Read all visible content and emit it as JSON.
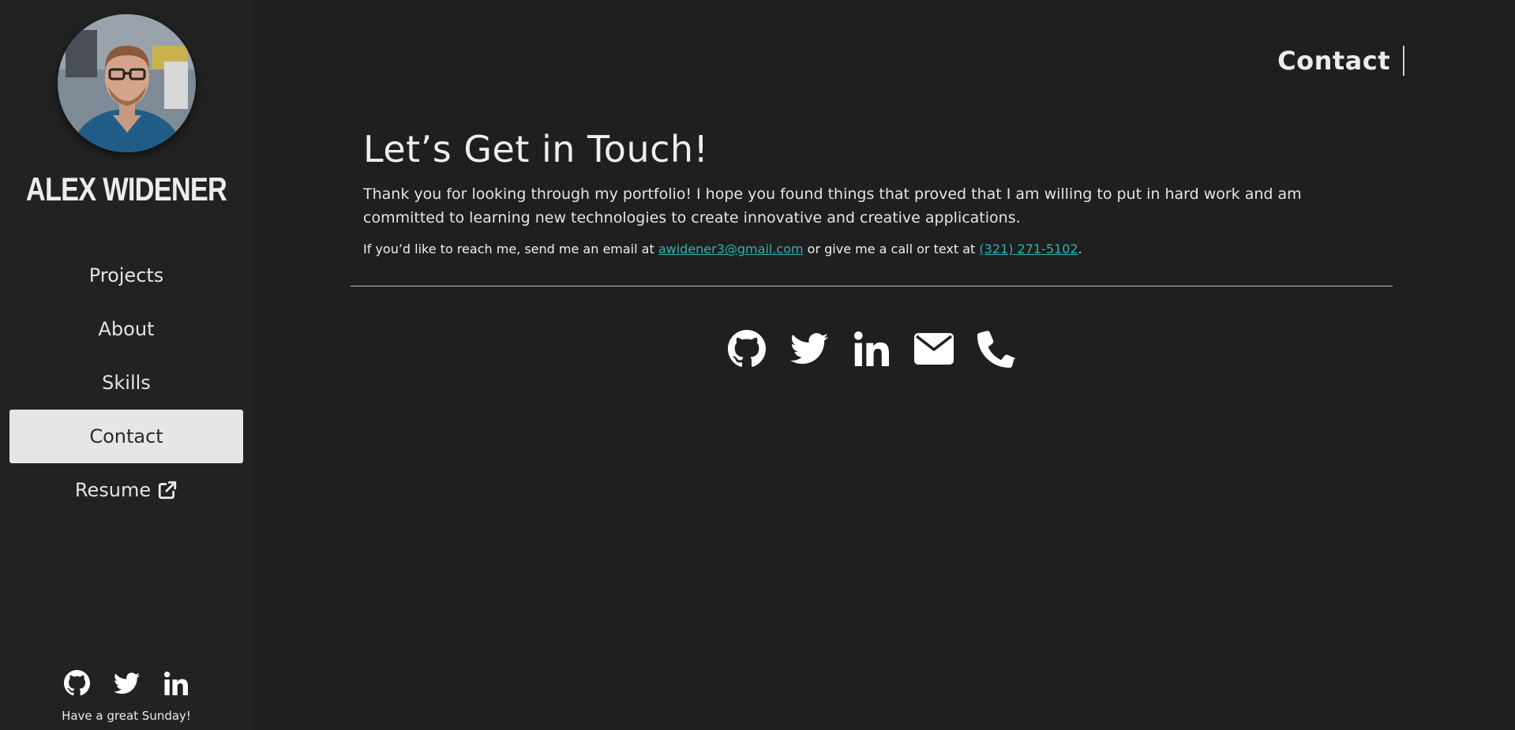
{
  "sidebar": {
    "name": "ALEX WIDENER",
    "nav": [
      {
        "label": "Projects"
      },
      {
        "label": "About"
      },
      {
        "label": "Skills"
      },
      {
        "label": "Contact",
        "active": true
      },
      {
        "label": "Resume",
        "icon": "external-link-icon"
      }
    ],
    "social_icons": [
      "github-icon",
      "twitter-icon",
      "linkedin-icon"
    ],
    "greeting": "Have a great Sunday!"
  },
  "header": {
    "page_label": "Contact"
  },
  "main": {
    "heading": "Let’s Get in Touch!",
    "intro": "Thank you for looking through my portfolio! I hope you found things that proved that I am willing to put in hard work and am committed to learning new technologies to create innovative and creative applications.",
    "reach_prefix": "If you’d like to reach me, send me an email at ",
    "email": "awidener3@gmail.com",
    "reach_middle": " or give me a call or text at ",
    "phone": "(321) 271-5102",
    "reach_suffix": ".",
    "contact_icons": [
      "github-icon",
      "twitter-icon",
      "linkedin-icon",
      "envelope-icon",
      "phone-icon"
    ]
  },
  "colors": {
    "background": "#1f1f1f",
    "sidebar": "#222222",
    "accent_link": "#2fb1b4",
    "active_nav": "#e6e6e6"
  }
}
